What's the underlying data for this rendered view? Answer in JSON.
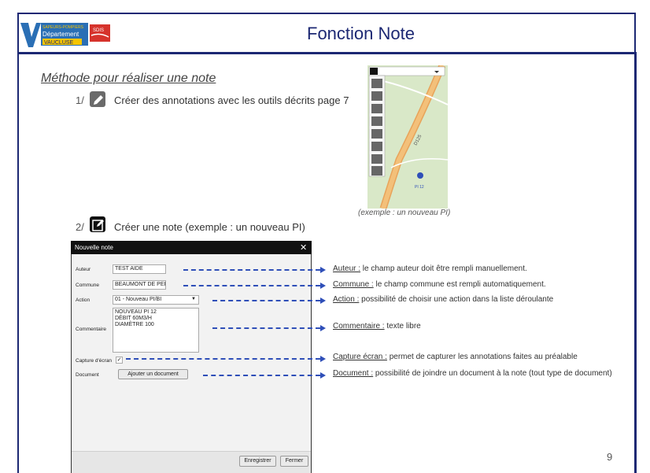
{
  "header": {
    "title": "Fonction Note",
    "logo_line1": "SAPEURS-POMPIERS",
    "logo_line2": "Département",
    "logo_line3": "VAUCLUSE",
    "logo_badge": "SDIS"
  },
  "section_title": "Méthode pour réaliser une note",
  "steps": [
    {
      "num": "1/",
      "text": "Créer des annotations  avec les outils décrits page 7"
    },
    {
      "num": "2/",
      "text": "Créer une note (exemple : un nouveau PI)"
    }
  ],
  "map": {
    "caption": "(exemple : un nouveau PI)",
    "road_label": "D125",
    "point_label": "PI 12"
  },
  "dialog": {
    "title": "Nouvelle note",
    "close": "✕",
    "labels": {
      "auteur": "Auteur",
      "commune": "Commune",
      "action": "Action",
      "commentaire": "Commentaire",
      "capture": "Capture d'écran",
      "document": "Document"
    },
    "values": {
      "auteur": "TEST AIDE",
      "commune": "BEAUMONT DE PER",
      "action": "01 - Nouveau PI/BI",
      "commentaire_lines": [
        "NOUVEAU PI 12",
        "DÉBIT 60M3/H",
        "DIAMÈTRE 100"
      ],
      "capture_checked": "✓"
    },
    "add_document_button": "Ajouter un document",
    "save_button": "Enregistrer",
    "close_button": "Fermer"
  },
  "annotations": [
    {
      "term": "Auteur :",
      "text": " le champ auteur doit être rempli manuellement."
    },
    {
      "term": "Commune :",
      "text": " le champ commune est rempli automatiquement."
    },
    {
      "term": "Action :",
      "text": " possibilité de choisir une action dans la liste déroulante"
    },
    {
      "term": "Commentaire :",
      "text": " texte libre"
    },
    {
      "term": "Capture écran :",
      "text": "  permet de capturer les annotations faites au préalable"
    },
    {
      "term": "Document :",
      "text": " possibilité de joindre un document à la note (tout type de document)"
    }
  ],
  "page_number": "9",
  "colors": {
    "accent": "#1c2873",
    "arrow": "#2f4fb8",
    "dialog_bar": "#111111"
  }
}
